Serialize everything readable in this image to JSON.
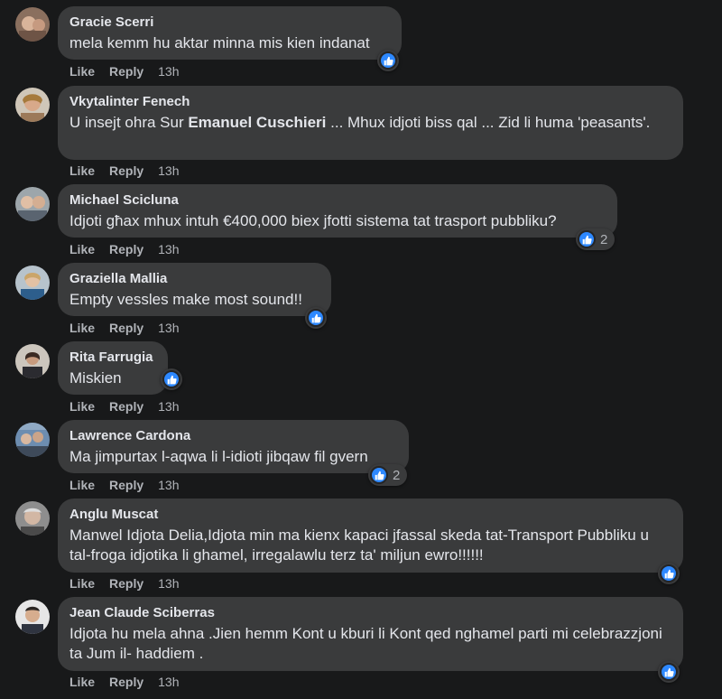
{
  "actions": {
    "like": "Like",
    "reply": "Reply"
  },
  "comments": [
    {
      "author": "Gracie Scerri",
      "text": "mela kemm hu aktar minna mis kien indanat",
      "time": "13h",
      "reactions": ""
    },
    {
      "author": "Vkytalinter Fenech",
      "text_before": "U insejt ohra Sur ",
      "mention": "Emanuel Cuschieri",
      "text_after": " ... Mhux idjoti biss qal ... Zid li huma 'peasants'.",
      "time": "13h"
    },
    {
      "author": "Michael Scicluna",
      "text": "Idjoti għax mhux intuh €400,000 biex jfotti sistema tat trasport pubbliku?",
      "time": "13h",
      "reactions": "2"
    },
    {
      "author": "Graziella Mallia",
      "text": "Empty vessles make most sound!!",
      "time": "13h",
      "reactions": ""
    },
    {
      "author": "Rita Farrugia",
      "text": "Miskien",
      "time": "13h",
      "reactions": ""
    },
    {
      "author": "Lawrence Cardona",
      "text": "Ma jimpurtax l-aqwa li l-idioti jibqaw fil gvern",
      "time": "13h",
      "reactions": "2"
    },
    {
      "author": "Anglu Muscat",
      "text": "Manwel Idjota Delia,Idjota min ma kienx kapaci jfassal skeda tat-Transport Pubbliku u tal-froga idjotika li ghamel, irregalawlu terz ta' miljun ewro!!!!!!",
      "time": "13h",
      "reactions": ""
    },
    {
      "author": "Jean Claude Sciberras",
      "text": "Idjota hu mela ahna .Jien hemm Kont u kburi li Kont qed nghamel parti mi celebrazzjoni ta Jum il- haddiem .",
      "time": "13h",
      "reactions": ""
    }
  ],
  "colors": {
    "background": "#18191a",
    "bubble": "#3a3b3c",
    "text": "#e4e6eb",
    "secondary": "#b0b3b8",
    "like_blue": "#2d88ff"
  },
  "icons": {
    "reaction": "like-thumb-icon"
  }
}
